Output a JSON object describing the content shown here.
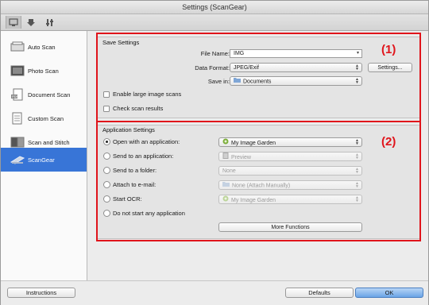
{
  "window": {
    "title": "Settings (ScanGear)"
  },
  "toolbar": {
    "tabs": [
      {
        "name": "scan-from-computer",
        "icon": "computer-scan-icon"
      },
      {
        "name": "scan-from-panel",
        "icon": "scanner-panel-icon"
      },
      {
        "name": "general-settings",
        "icon": "tools-icon"
      }
    ]
  },
  "sidebar": {
    "items": [
      {
        "label": "Auto Scan",
        "icon": "auto-scan-icon"
      },
      {
        "label": "Photo Scan",
        "icon": "photo-scan-icon"
      },
      {
        "label": "Document Scan",
        "icon": "document-scan-icon"
      },
      {
        "label": "Custom Scan",
        "icon": "custom-scan-icon"
      },
      {
        "label": "Scan and Stitch",
        "icon": "scan-stitch-icon"
      },
      {
        "label": "ScanGear",
        "icon": "scangear-icon",
        "selected": true
      }
    ]
  },
  "save_settings": {
    "title": "Save Settings",
    "file_name_label": "File Name:",
    "file_name_value": "IMG",
    "data_format_label": "Data Format:",
    "data_format_value": "JPEG/Exif",
    "settings_button": "Settings...",
    "save_in_label": "Save in:",
    "save_in_value": "Documents",
    "enable_large_label": "Enable large image scans",
    "check_results_label": "Check scan results",
    "annotation": "(1)"
  },
  "app_settings": {
    "title": "Application Settings",
    "annotation": "(2)",
    "options": [
      {
        "label": "Open with an application:",
        "value": "My Image Garden",
        "selected": true,
        "enabled": true
      },
      {
        "label": "Send to an application:",
        "value": "Preview",
        "selected": false,
        "enabled": false
      },
      {
        "label": "Send to a folder:",
        "value": "None",
        "selected": false,
        "enabled": false
      },
      {
        "label": "Attach to e-mail:",
        "value": "None (Attach Manually)",
        "selected": false,
        "enabled": false
      },
      {
        "label": "Start OCR:",
        "value": "My Image Garden",
        "selected": false,
        "enabled": false
      },
      {
        "label": "Do not start any application",
        "selected": false
      }
    ],
    "more_functions": "More Functions"
  },
  "footer": {
    "instructions": "Instructions",
    "defaults": "Defaults",
    "ok": "OK"
  },
  "colors": {
    "selection": "#3875d7",
    "annotation_red": "#e0141b"
  }
}
